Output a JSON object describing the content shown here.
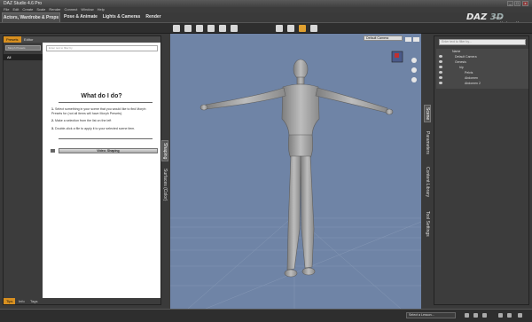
{
  "window": {
    "title": "DAZ Studio 4.6 Pro",
    "min": "_",
    "max": "□",
    "close": "x"
  },
  "menu": [
    "File",
    "Edit",
    "Create",
    "Scale",
    "Render",
    "Connect",
    "Window",
    "Help"
  ],
  "brand": {
    "logo_main": "DAZ",
    "logo_accent": "3D",
    "home": "Home",
    "account": "My Account",
    "gallery": "My Gallery"
  },
  "tabs": [
    "Actors, Wardrobe & Props",
    "Pose & Animate",
    "Lights & Cameras",
    "Render"
  ],
  "left_panel": {
    "tab_presets": "Presets",
    "tab_editor": "Editor",
    "selector": "Morph Presets",
    "category_all": "All",
    "filter_placeholder": "Enter text to filter by",
    "help_title": "What do I do?",
    "steps": [
      {
        "num": "1.",
        "text": "Select something in your scene that you would like to find Morph Presets for (not all items will have Morph Presets)."
      },
      {
        "num": "2.",
        "text": "Make a selection from the list on the left"
      },
      {
        "num": "3.",
        "text": "Double-click a file to apply it to your selected scene item."
      }
    ],
    "video_button": "Video: Shaping",
    "bottom_tabs": [
      "Tips",
      "Info",
      "Tags"
    ]
  },
  "left_strip_tabs": [
    "Shaping",
    "Surfaces (Color)"
  ],
  "viewport": {
    "camera": "Default Camera"
  },
  "right_strip_tabs": [
    "Scene",
    "Parameters",
    "Content Library",
    "Tool Settings"
  ],
  "right_panel": {
    "search_placeholder": "Enter text to filter by...",
    "tree": [
      {
        "label": "Name",
        "indent": 0
      },
      {
        "label": "Default Camera",
        "indent": 1
      },
      {
        "label": "Genesis",
        "indent": 1
      },
      {
        "label": "hip",
        "indent": 2
      },
      {
        "label": "Pelvis",
        "indent": 3
      },
      {
        "label": "Abdomen",
        "indent": 3
      },
      {
        "label": "Abdomen 2",
        "indent": 3
      }
    ]
  },
  "status": {
    "lesson_select": "Select a Lesson..."
  }
}
